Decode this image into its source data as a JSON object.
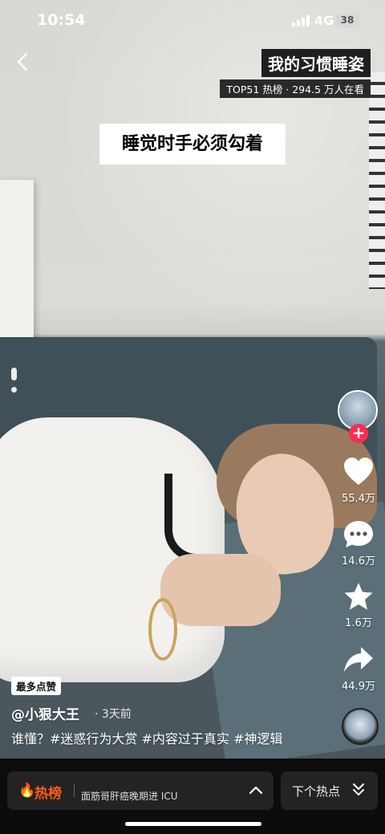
{
  "status_bar": {
    "time": "10:54",
    "network": "4G",
    "battery": "38"
  },
  "header": {
    "title": "我的习惯睡姿",
    "hot_info": "TOP51 热榜 · 294.5 万人在看"
  },
  "video": {
    "caption": "睡觉时手必须勾着"
  },
  "actions": {
    "likes": "55.4万",
    "comments": "14.6万",
    "favorites": "1.6万",
    "shares": "44.9万"
  },
  "post": {
    "badge": "最多点赞",
    "author": "@小狠大王",
    "time_ago": "· 3天前",
    "description": "谁懂？#迷惑行为大赏 #内容过于真实 #神逻辑"
  },
  "bottom_bar": {
    "hot_label": "热榜",
    "ticker": "面筋哥肝癌晚期进 ICU",
    "next_label": "下个热点"
  },
  "colors": {
    "accent": "#fe2c55",
    "hot": "#ff5a1f"
  }
}
